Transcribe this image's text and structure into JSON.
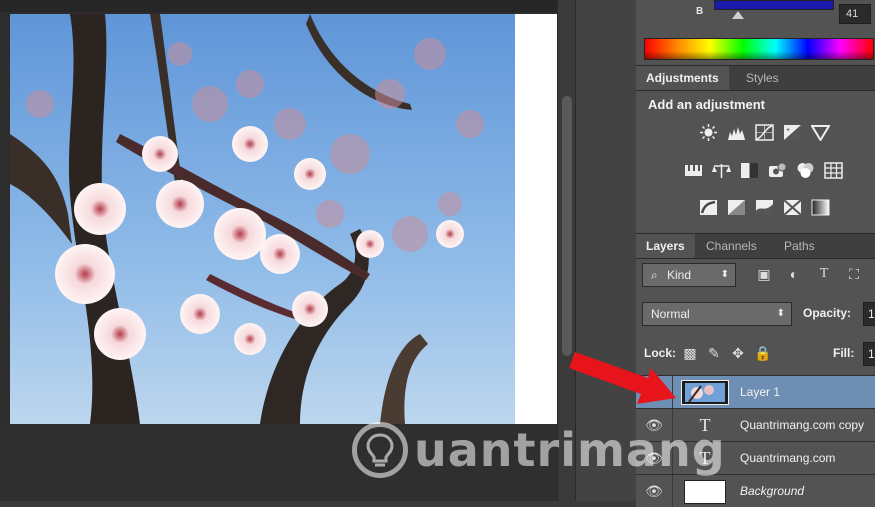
{
  "color_panel": {
    "channel_label": "B",
    "channel_value": "41"
  },
  "adjustments": {
    "tabs": [
      {
        "label": "Adjustments",
        "active": true
      },
      {
        "label": "Styles",
        "active": false
      }
    ],
    "heading": "Add an adjustment",
    "icon_rows": [
      [
        "brightness-contrast-icon",
        "levels-icon",
        "curves-icon",
        "exposure-icon",
        "vibrance-icon"
      ],
      [
        "hue-saturation-icon",
        "color-balance-icon",
        "black-white-icon",
        "photo-filter-icon",
        "channel-mixer-icon",
        "color-lookup-icon"
      ],
      [
        "invert-icon",
        "posterize-icon",
        "threshold-icon",
        "selective-color-icon",
        "gradient-map-icon"
      ]
    ]
  },
  "layers_panel": {
    "tabs": [
      {
        "label": "Layers",
        "active": true
      },
      {
        "label": "Channels",
        "active": false
      },
      {
        "label": "Paths",
        "active": false
      }
    ],
    "filter_kind": "Kind",
    "blend_mode": "Normal",
    "opacity_label": "Opacity:",
    "opacity_value": "1",
    "lock_label": "Lock:",
    "fill_label": "Fill:",
    "fill_value": "1",
    "layers": [
      {
        "name": "Layer 1",
        "type": "image",
        "visible": false,
        "selected": true
      },
      {
        "name": "Quantrimang.com copy",
        "type": "text",
        "visible": true,
        "selected": false
      },
      {
        "name": "Quantrimang.com",
        "type": "text",
        "visible": true,
        "selected": false
      },
      {
        "name": "Background",
        "type": "background",
        "visible": true,
        "selected": false
      }
    ],
    "text_layer_glyph": "T"
  },
  "watermark": {
    "text": "uantrimang"
  },
  "colors": {
    "selected_layer": "#6f8eb4",
    "arrow": "#e8141b",
    "panel_bg": "#535353"
  }
}
